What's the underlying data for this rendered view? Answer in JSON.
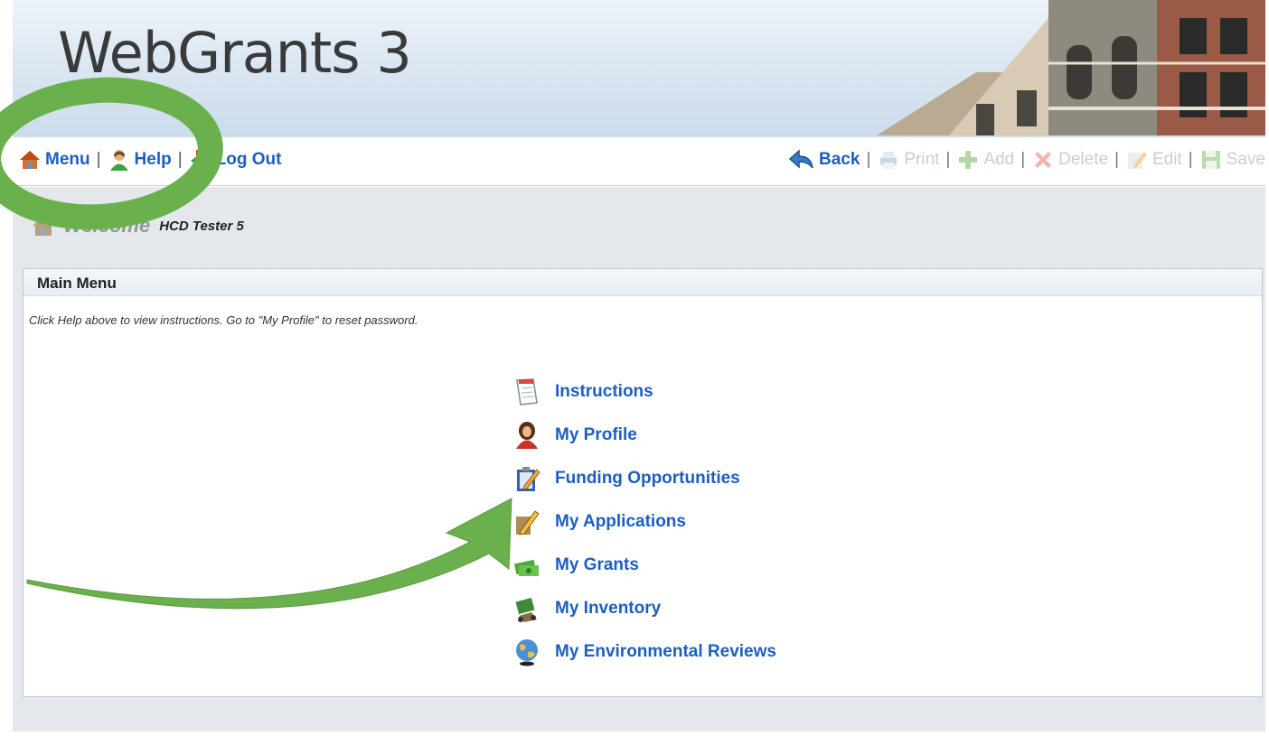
{
  "header": {
    "app_title": "WebGrants 3"
  },
  "toolbar": {
    "left": [
      {
        "label": "Menu",
        "icon": "home-icon"
      },
      {
        "label": "Help",
        "icon": "person-help-icon"
      },
      {
        "label": "Log Out",
        "icon": "exit-door-icon"
      }
    ],
    "right": [
      {
        "label": "Back",
        "icon": "back-arrow-icon",
        "enabled": true
      },
      {
        "label": "Print",
        "icon": "printer-icon",
        "enabled": false
      },
      {
        "label": "Add",
        "icon": "plus-icon",
        "enabled": false
      },
      {
        "label": "Delete",
        "icon": "delete-x-icon",
        "enabled": false
      },
      {
        "label": "Edit",
        "icon": "pencil-icon",
        "enabled": false
      },
      {
        "label": "Save",
        "icon": "floppy-icon",
        "enabled": false
      }
    ],
    "separator": "|"
  },
  "welcome": {
    "label": "Welcome",
    "user": "HCD Tester 5"
  },
  "main_menu": {
    "title": "Main Menu",
    "note": "Click Help above to view instructions. Go to \"My Profile\" to reset password.",
    "items": [
      {
        "label": "Instructions",
        "icon": "document-icon"
      },
      {
        "label": "My Profile",
        "icon": "user-profile-icon"
      },
      {
        "label": "Funding Opportunities",
        "icon": "clipboard-pencil-icon"
      },
      {
        "label": "My Applications",
        "icon": "application-pencil-icon"
      },
      {
        "label": "My Grants",
        "icon": "money-icon"
      },
      {
        "label": "My Inventory",
        "icon": "inventory-icon"
      },
      {
        "label": "My Environmental Reviews",
        "icon": "globe-icon"
      }
    ]
  },
  "colors": {
    "link": "#1c5fc2",
    "annotation": "#6ab04c",
    "disabled": "#c4cfd9"
  }
}
